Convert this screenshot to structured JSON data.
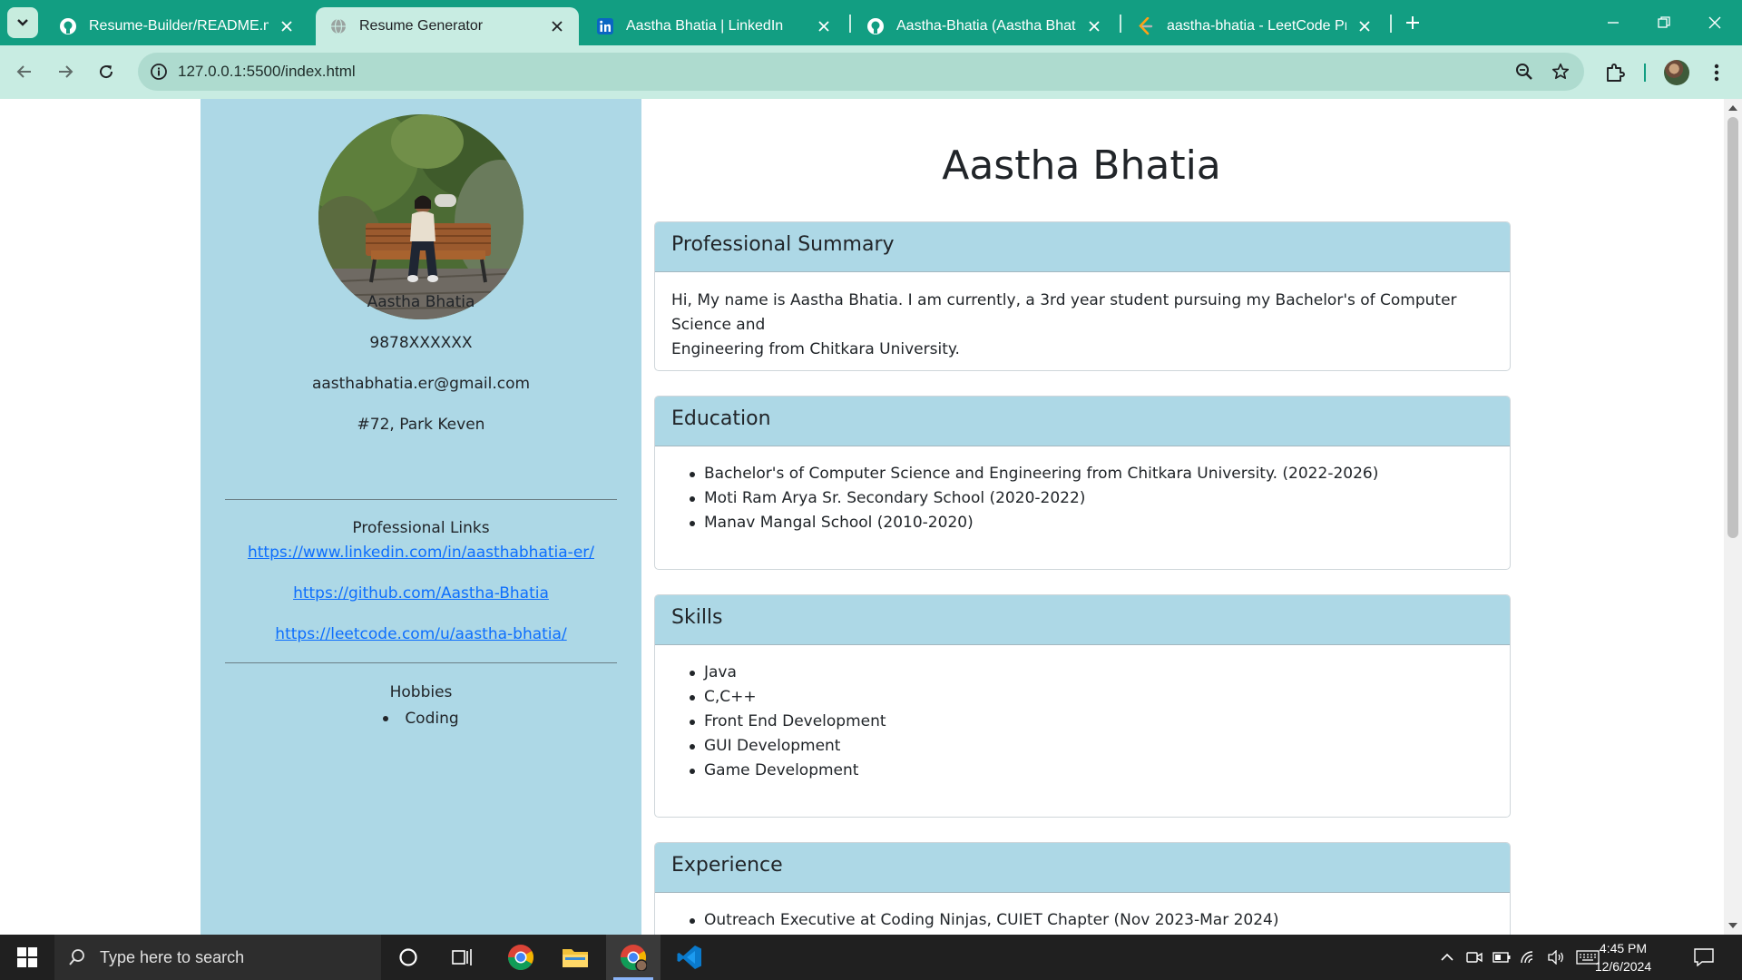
{
  "browser": {
    "tabs": [
      {
        "title": "Resume-Builder/README.md at",
        "favicon": "github-icon",
        "active": false
      },
      {
        "title": "Resume Generator",
        "favicon": "globe-icon",
        "active": true
      },
      {
        "title": "Aastha Bhatia | LinkedIn",
        "favicon": "linkedin-icon",
        "active": false
      },
      {
        "title": "Aastha-Bhatia (Aastha Bhatia)",
        "favicon": "github-icon",
        "active": false
      },
      {
        "title": "aastha-bhatia - LeetCode Profile",
        "favicon": "leetcode-icon",
        "active": false
      }
    ],
    "url": "127.0.0.1:5500/index.html",
    "colors": {
      "frame": "#129e82",
      "toolbar": "#c8ece2",
      "omnibox": "#aedbcf"
    }
  },
  "page": {
    "sidebar": {
      "name": "Aastha Bhatia",
      "phone": "9878XXXXXX",
      "email": "aasthabhatia.er@gmail.com",
      "address": "#72, Park Keven",
      "links_heading": "Professional Links",
      "links": [
        "https://www.linkedin.com/in/aasthabhatia-er/",
        "https://github.com/Aastha-Bhatia",
        "https://leetcode.com/u/aastha-bhatia/"
      ],
      "hobbies_heading": "Hobbies",
      "hobbies": [
        "Coding"
      ],
      "bg_color": "#add8e6"
    },
    "main": {
      "name": "Aastha Bhatia",
      "summary_heading": "Professional Summary",
      "summary_lines": [
        "Hi, My name is Aastha Bhatia. I am currently, a 3rd year student pursuing my Bachelor's of Computer Science and",
        "Engineering from Chitkara University."
      ],
      "education_heading": "Education",
      "education": [
        "Bachelor's of Computer Science and Engineering from Chitkara University. (2022-2026)",
        "Moti Ram Arya Sr. Secondary School (2020-2022)",
        "Manav Mangal School (2010-2020)"
      ],
      "skills_heading": "Skills",
      "skills": [
        "Java",
        "C,C++",
        "Front End Development",
        "GUI Development",
        "Game Development"
      ],
      "experience_heading": "Experience",
      "experience": [
        "Outreach Executive at Coding Ninjas, CUIET Chapter (Nov 2023-Mar 2024)"
      ]
    }
  },
  "taskbar": {
    "search_placeholder": "Type here to search",
    "time": "4:45 PM",
    "date": "12/6/2024"
  }
}
